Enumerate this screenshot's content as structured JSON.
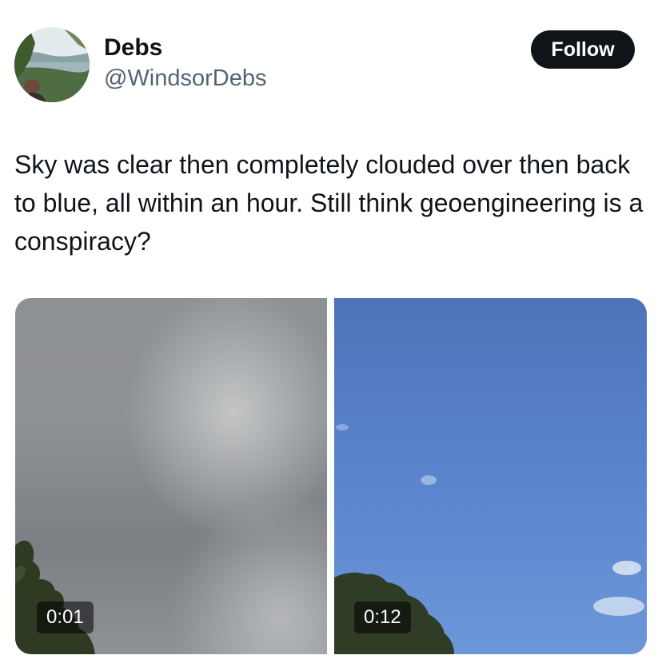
{
  "user": {
    "display_name": "Debs",
    "handle": "@WindsorDebs",
    "follow_label": "Follow"
  },
  "tweet": {
    "text": "Sky was clear then completely clouded over then back to blue, all within an hour. Still think geoengineering is a conspiracy?"
  },
  "media": [
    {
      "timestamp": "0:01",
      "description": "cloudy-sky-video"
    },
    {
      "timestamp": "0:12",
      "description": "blue-sky-video"
    }
  ],
  "colors": {
    "follow_bg": "#0f1419",
    "handle": "#536471",
    "text": "#0f1419"
  }
}
